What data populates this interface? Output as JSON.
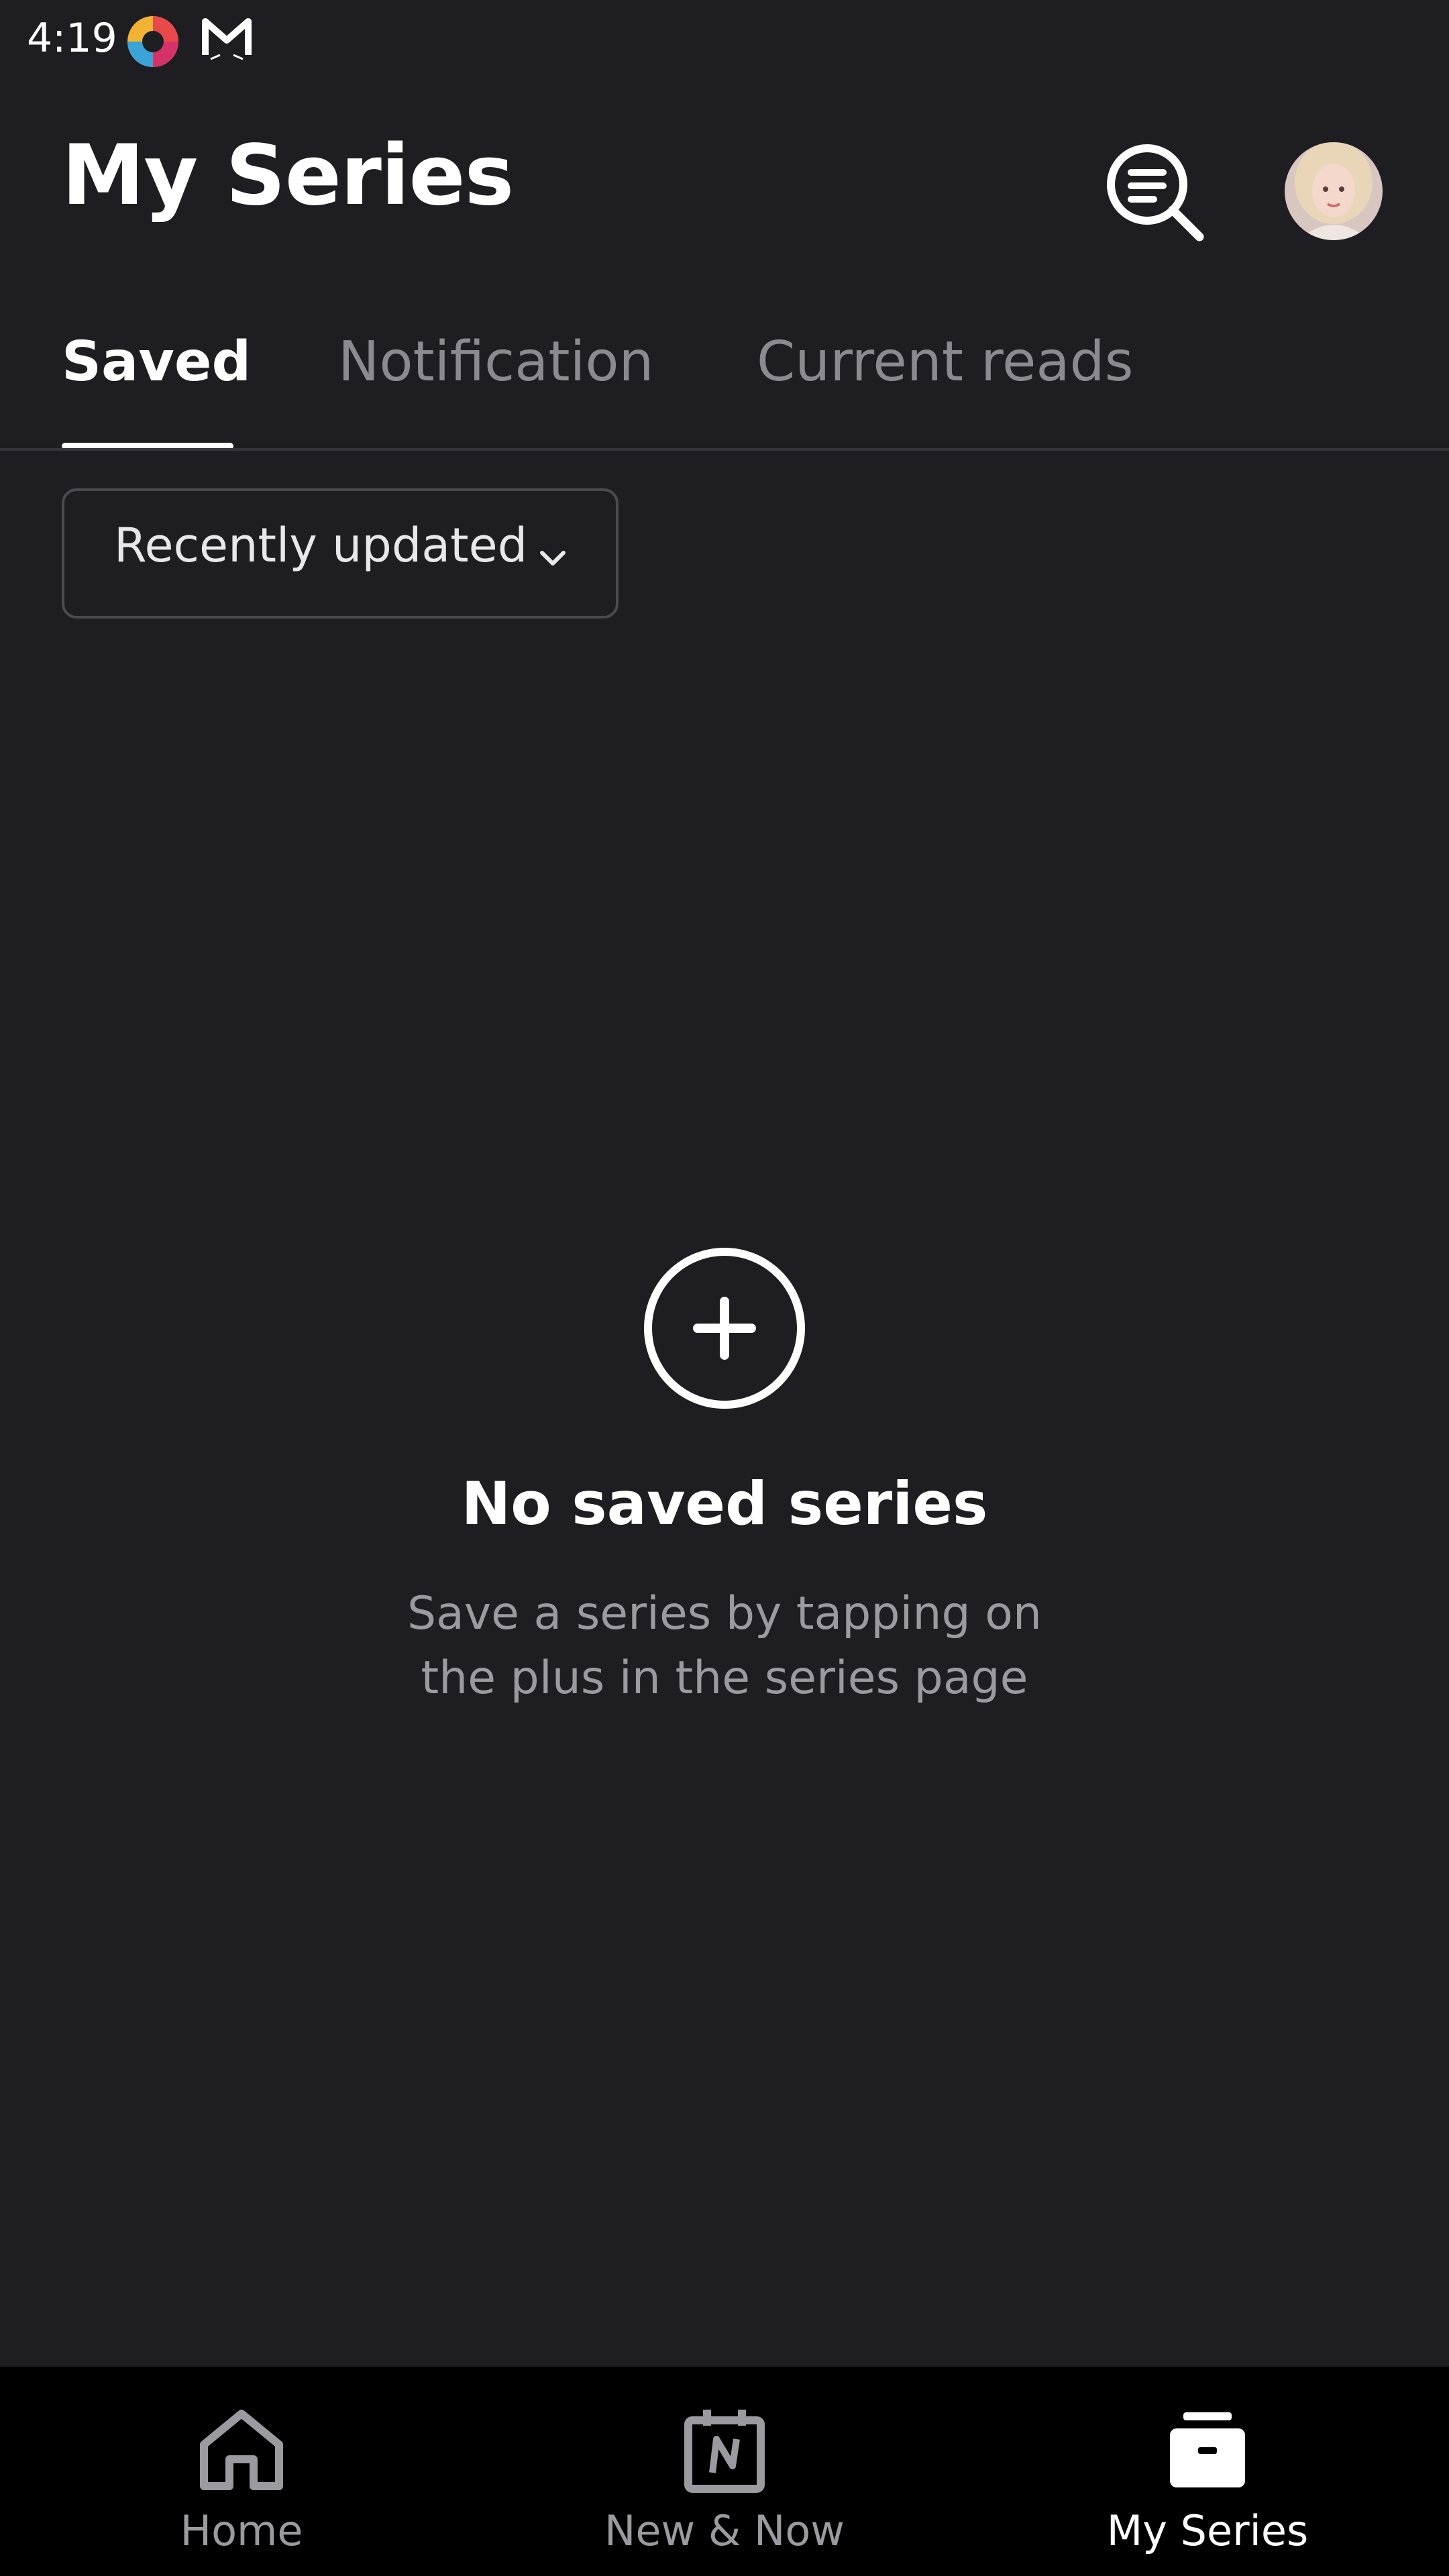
{
  "status_bar": {
    "time": "4:19",
    "icons": [
      "browser-app-icon",
      "mail-app-icon"
    ]
  },
  "header": {
    "title": "My Series",
    "search_icon": "search-list-icon",
    "avatar_icon": "profile-avatar"
  },
  "tabs": [
    {
      "label": "Saved",
      "active": true
    },
    {
      "label": "Notification",
      "active": false
    },
    {
      "label": "Current reads",
      "active": false
    }
  ],
  "sort": {
    "selected": "Recently updated",
    "icon": "chevron-down-icon"
  },
  "empty_state": {
    "icon": "plus-circle-icon",
    "title": "No saved series",
    "subtitle_line1": "Save a series by tapping on",
    "subtitle_line2": "the plus in the series page"
  },
  "bottom_nav": [
    {
      "label": "Home",
      "icon": "home-icon",
      "active": false
    },
    {
      "label": "New & Now",
      "icon": "calendar-new-icon",
      "active": false
    },
    {
      "label": "My Series",
      "icon": "archive-box-icon",
      "active": true
    }
  ],
  "colors": {
    "background": "#1e1e22",
    "nav_background": "#000000",
    "active_text": "#ffffff",
    "inactive_text": "#8a8a90"
  }
}
